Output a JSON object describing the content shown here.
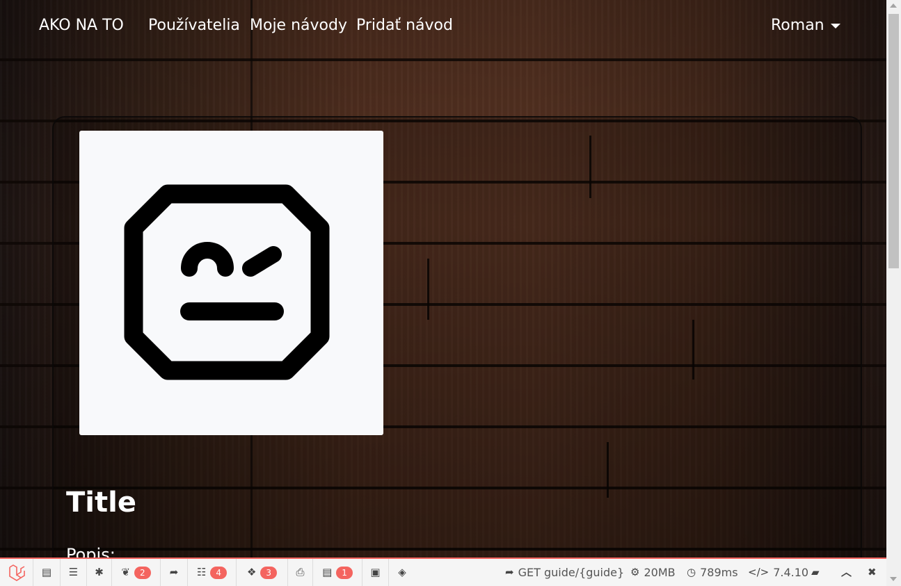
{
  "nav": {
    "brand": "AKO NA TO",
    "links": [
      "Používatelia",
      "Moje návody",
      "Pridať návod"
    ],
    "user": "Roman"
  },
  "content": {
    "title": "Title",
    "description_label": "Popis:",
    "image_icon": "robot-face-icon"
  },
  "debugbar": {
    "counts": {
      "messages": "2",
      "queries": "4",
      "models": "3",
      "views": "1"
    },
    "route": "GET guide/{guide}",
    "memory": "20MB",
    "time": "789ms",
    "version": "7.4.10",
    "accent_color": "#f4645f"
  }
}
